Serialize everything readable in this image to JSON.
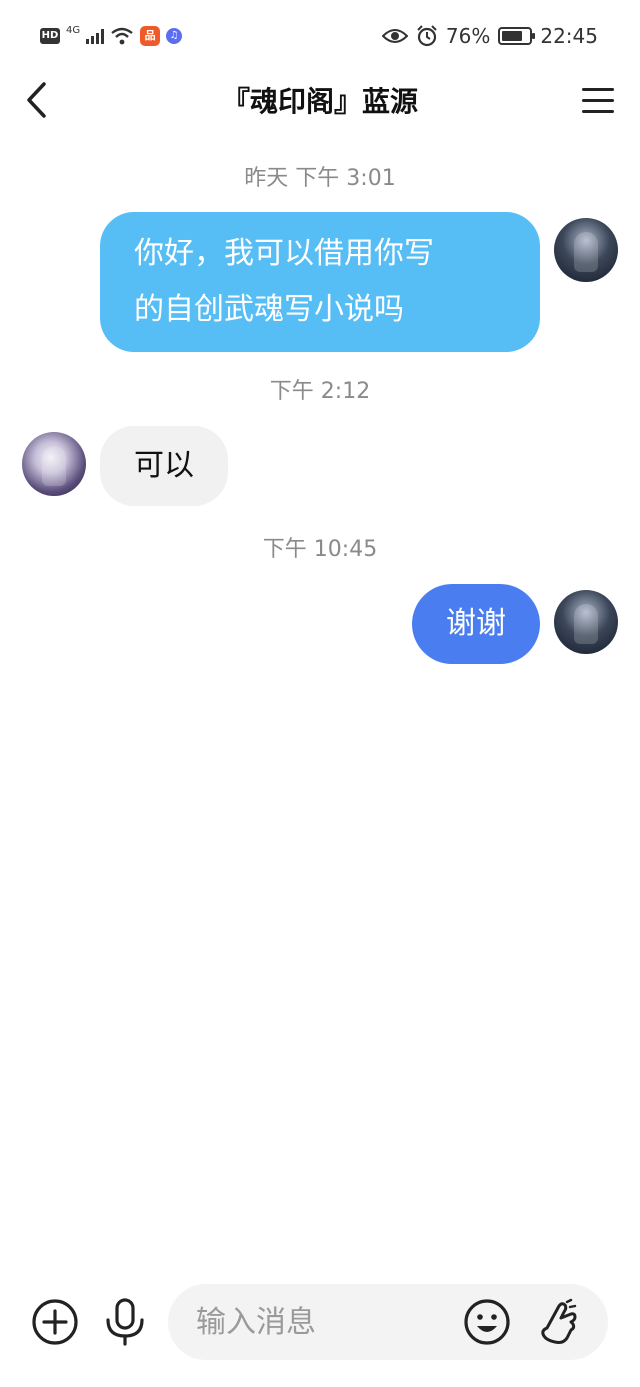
{
  "status_bar": {
    "hd": "HD",
    "network": "4G",
    "app_badge": "品",
    "music_glyph": "♫",
    "battery_level": 76,
    "battery_text": "76%",
    "time": "22:45",
    "icons": [
      "hd-icon",
      "signal-icon",
      "wifi-icon",
      "app-icon",
      "music-icon",
      "eye-icon",
      "alarm-icon",
      "battery-icon"
    ]
  },
  "header": {
    "title": "『魂印阁』蓝源",
    "back_icon": "chevron-left-icon",
    "menu_icon": "hamburger-menu-icon"
  },
  "messages": [
    {
      "timestamp": "昨天 下午 3:01",
      "sender": "self",
      "lines": [
        "你好，我可以借用你写",
        "的自创武魂写小说吗"
      ]
    },
    {
      "timestamp": "下午 2:12",
      "sender": "other",
      "lines": [
        "可以"
      ]
    },
    {
      "timestamp": "下午 10:45",
      "sender": "self",
      "lines": [
        "谢谢"
      ]
    }
  ],
  "input_bar": {
    "placeholder": "输入消息",
    "icons": [
      "add-circle-icon",
      "microphone-icon",
      "emoji-icon",
      "gesture-hand-icon"
    ]
  },
  "colors": {
    "bubble_light_blue": "#57bdf5",
    "bubble_blue": "#4a7ef0",
    "bubble_gray": "#f1f1f1",
    "timestamp_gray": "#8a8a8a"
  }
}
